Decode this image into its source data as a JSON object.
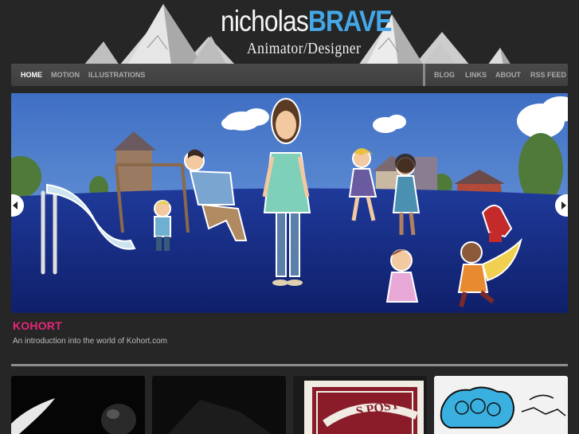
{
  "site": {
    "name_first": "nicholas",
    "name_second": "BRAVE",
    "tagline": "Animator/Designer"
  },
  "nav": {
    "left_items": [
      {
        "label": "HOME",
        "active": true
      },
      {
        "label": "MOTION",
        "active": false
      },
      {
        "label": "ILLUSTRATIONS",
        "active": false
      }
    ],
    "right_items": [
      {
        "label": "BLOG"
      },
      {
        "label": "LINKS"
      },
      {
        "label": "ABOUT"
      },
      {
        "label": "RSS FEED"
      }
    ]
  },
  "slider": {
    "prev_icon": "chevron-left-icon",
    "next_icon": "chevron-right-icon",
    "title": "KOHORT",
    "description": "An introduction into the world of Kohort.com"
  },
  "colors": {
    "accent_pink": "#e8257a",
    "brand_blue": "#44a8e8",
    "background": "#262626"
  }
}
